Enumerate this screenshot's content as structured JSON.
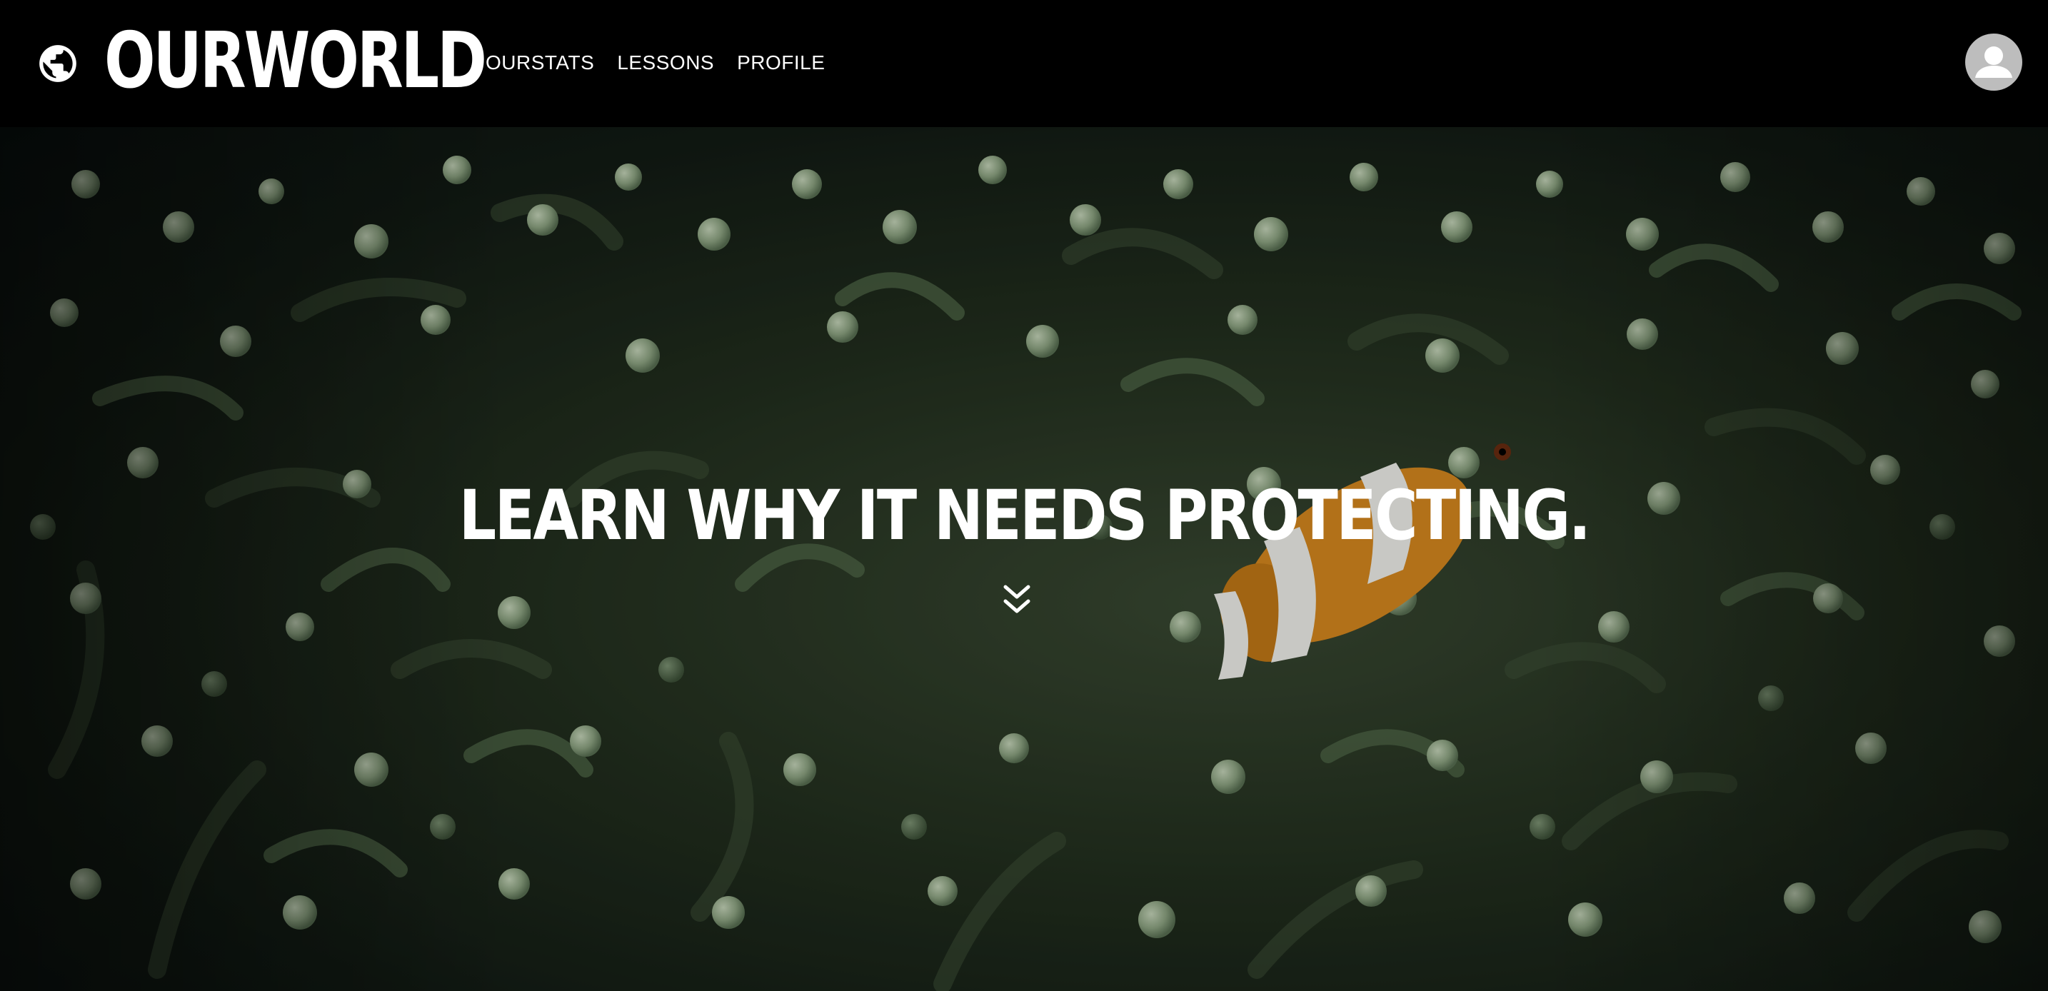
{
  "header": {
    "brand": "OURWORLD",
    "logo_icon": "globe-icon",
    "nav": [
      {
        "label": "OURSTATS"
      },
      {
        "label": "LESSONS"
      },
      {
        "label": "PROFILE"
      }
    ],
    "avatar_icon": "user-icon"
  },
  "hero": {
    "headline": "LEARN WHY IT NEEDS PROTECTING.",
    "scroll_icon": "double-chevron-down-icon",
    "background": "clownfish-in-sea-anemone-photo"
  },
  "colors": {
    "header_bg": "#000000",
    "text": "#ffffff",
    "avatar_bg": "#bdbdbd",
    "clownfish_orange": "#d98a1f"
  }
}
